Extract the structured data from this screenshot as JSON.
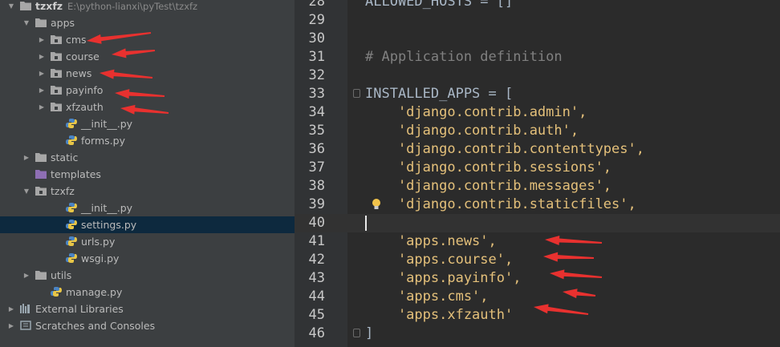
{
  "project_tree": {
    "root_label": "tzxfz",
    "root_path": "E:\\python-lianxi\\pyTest\\tzxfz",
    "items": [
      {
        "label": "apps",
        "indent": 1,
        "type": "folder",
        "expanded": true
      },
      {
        "label": "cms",
        "indent": 2,
        "type": "package",
        "expanded": false
      },
      {
        "label": "course",
        "indent": 2,
        "type": "package",
        "expanded": false
      },
      {
        "label": "news",
        "indent": 2,
        "type": "package",
        "expanded": false
      },
      {
        "label": "payinfo",
        "indent": 2,
        "type": "package",
        "expanded": false
      },
      {
        "label": "xfzauth",
        "indent": 2,
        "type": "package",
        "expanded": false
      },
      {
        "label": "__init__.py",
        "indent": 3,
        "type": "python"
      },
      {
        "label": "forms.py",
        "indent": 3,
        "type": "python"
      },
      {
        "label": "static",
        "indent": 1,
        "type": "folder",
        "expanded": false
      },
      {
        "label": "templates",
        "indent": 1,
        "type": "templates-folder"
      },
      {
        "label": "tzxfz",
        "indent": 1,
        "type": "package",
        "expanded": true
      },
      {
        "label": "__init__.py",
        "indent": 3,
        "type": "python"
      },
      {
        "label": "settings.py",
        "indent": 3,
        "type": "python",
        "selected": true
      },
      {
        "label": "urls.py",
        "indent": 3,
        "type": "python"
      },
      {
        "label": "wsgi.py",
        "indent": 3,
        "type": "python"
      },
      {
        "label": "utils",
        "indent": 1,
        "type": "folder",
        "expanded": false
      },
      {
        "label": "manage.py",
        "indent": 2,
        "type": "python"
      },
      {
        "label": "External Libraries",
        "indent": 0,
        "type": "libraries",
        "expanded": false
      },
      {
        "label": "Scratches and Consoles",
        "indent": 0,
        "type": "scratches",
        "expanded": false
      }
    ]
  },
  "editor": {
    "lines": [
      {
        "n": "28",
        "text": "ALLOWED_HOSTS = []",
        "kind": "plain"
      },
      {
        "n": "29",
        "text": "",
        "kind": "plain"
      },
      {
        "n": "30",
        "text": "",
        "kind": "plain"
      },
      {
        "n": "31",
        "text": "# Application definition",
        "kind": "comment"
      },
      {
        "n": "32",
        "text": "",
        "kind": "plain"
      },
      {
        "n": "33",
        "text": "INSTALLED_APPS = [",
        "kind": "plain",
        "fold": true
      },
      {
        "n": "34",
        "text": "    'django.contrib.admin',",
        "kind": "string"
      },
      {
        "n": "35",
        "text": "    'django.contrib.auth',",
        "kind": "string"
      },
      {
        "n": "36",
        "text": "    'django.contrib.contenttypes',",
        "kind": "string"
      },
      {
        "n": "37",
        "text": "    'django.contrib.sessions',",
        "kind": "string"
      },
      {
        "n": "38",
        "text": "    'django.contrib.messages',",
        "kind": "string"
      },
      {
        "n": "39",
        "text": "    'django.contrib.staticfiles',",
        "kind": "string",
        "bulb": true
      },
      {
        "n": "40",
        "text": "",
        "kind": "plain",
        "current": true
      },
      {
        "n": "41",
        "text": "    'apps.news',",
        "kind": "string"
      },
      {
        "n": "42",
        "text": "    'apps.course',",
        "kind": "string"
      },
      {
        "n": "43",
        "text": "    'apps.payinfo',",
        "kind": "string"
      },
      {
        "n": "44",
        "text": "    'apps.cms',",
        "kind": "string"
      },
      {
        "n": "45",
        "text": "    'apps.xfzauth'",
        "kind": "string"
      },
      {
        "n": "46",
        "text": "]",
        "kind": "plain",
        "fold": true
      }
    ]
  },
  "colors": {
    "sidebar_bg": "#3c3f41",
    "editor_bg": "#2b2b2b",
    "string": "#e4c07a",
    "comment": "#808080",
    "selection": "#0d293e",
    "annotation_arrow": "#e8312f"
  }
}
